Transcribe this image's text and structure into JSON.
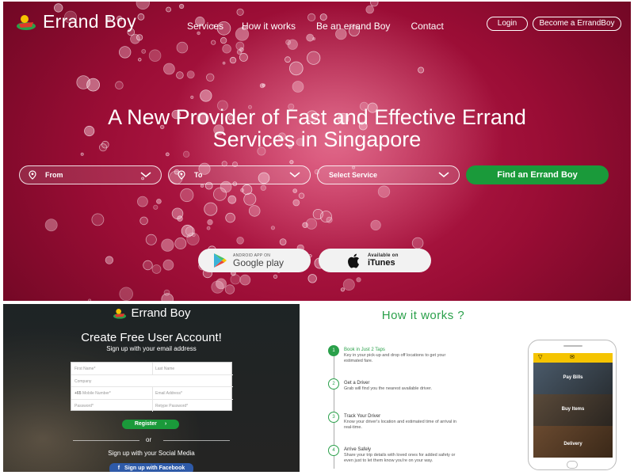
{
  "header": {
    "brand": "Errand Boy",
    "nav": [
      "Services",
      "How it works",
      "Be an errand Boy",
      "Contact"
    ],
    "login": "Login",
    "become": "Become a ErrandBoy"
  },
  "hero": {
    "headline_line1": "A New Provider of Fast and Effective Errand",
    "headline_line2": "Services in Singapore",
    "from_placeholder": "From",
    "to_placeholder": "To",
    "service_placeholder": "Select Service",
    "find_button": "Find an Errand Boy",
    "google_small": "ANDROID APP ON",
    "google_big": "Google play",
    "itunes_small": "Available on",
    "itunes_big": "iTunes"
  },
  "signup": {
    "brand": "Errand Boy",
    "title": "Create Free User Account!",
    "subtitle": "Sign up with your email address",
    "fields": {
      "first_name": "First Name*",
      "last_name": "Last Name",
      "company": "Company",
      "mobile_prefix": "+65",
      "mobile": "Mobile Number*",
      "email": "Email Address*",
      "password": "Password*",
      "retype_password": "Retype Password*"
    },
    "register": "Register",
    "or": "or",
    "social_title": "Sign up with your Social Media",
    "facebook": "Sign up with Facebook"
  },
  "how": {
    "title": "How it works ?",
    "steps": [
      {
        "num": "1",
        "title": "Book in Just 2 Taps",
        "desc": "Key in your pick-up and drop off locations to get your estimated fare."
      },
      {
        "num": "2",
        "title": "Get a Driver",
        "desc": "Grab will find you the nearest available driver."
      },
      {
        "num": "3",
        "title": "Track Your Driver",
        "desc": "Know your driver's location and estimated time of arrival in real-time."
      },
      {
        "num": "4",
        "title": "Arrive Safely",
        "desc": "Share your trip details with loved ones for added safety or even just to let them know you're on your way."
      }
    ],
    "phone_sections": [
      "Pay Bills",
      "Buy Items",
      "Delivery"
    ]
  },
  "colors": {
    "brand_green": "#1a9a3a",
    "hero_red": "#9a0d35",
    "facebook_blue": "#2e5aa8",
    "app_yellow": "#f5c400"
  }
}
